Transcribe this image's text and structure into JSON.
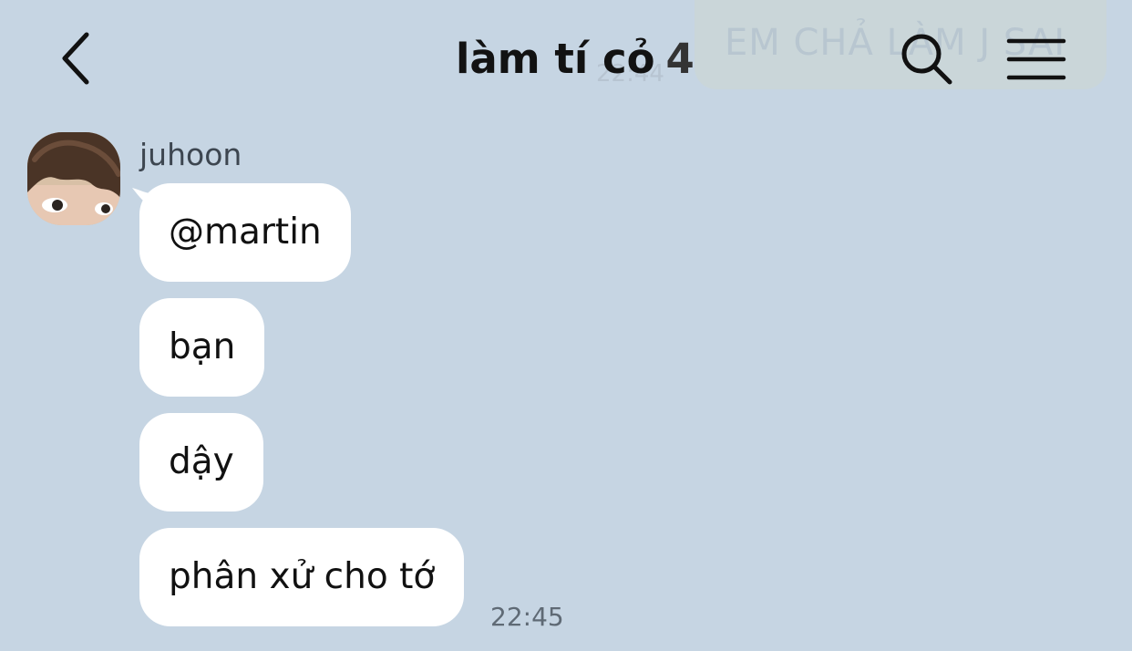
{
  "background_color": "#c6d5e3",
  "ghost": {
    "text": "EM CHẢ LÀM J SAI",
    "time": "22:44"
  },
  "header": {
    "title": "làm tí cỏ",
    "member_count": "4",
    "icons": {
      "back": "chevron-left-icon",
      "search": "search-icon",
      "menu": "hamburger-menu-icon"
    }
  },
  "conversation": {
    "sender": "juhoon",
    "messages": [
      {
        "text": "@martin"
      },
      {
        "text": "bạn"
      },
      {
        "text": "dậy"
      },
      {
        "text": "phân xử cho tớ"
      }
    ],
    "timestamp": "22:45"
  }
}
